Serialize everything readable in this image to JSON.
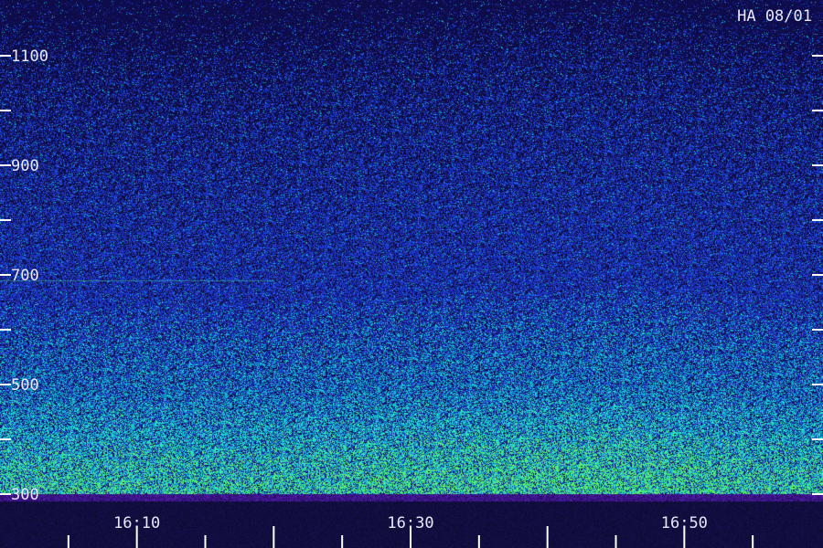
{
  "chart_data": {
    "type": "heatmap",
    "title": "HA 08/01",
    "y_ticks": [
      "1100",
      "900",
      "700",
      "500",
      "300"
    ],
    "y_tick_values": [
      1100,
      900,
      700,
      500,
      300
    ],
    "ylim": [
      300,
      1200
    ],
    "x_ticks": [
      "16:10",
      "16:30",
      "16:50"
    ],
    "x_tick_minutes": [
      10,
      30,
      50
    ],
    "xlim_minutes": [
      0,
      60
    ],
    "minor_ticks": {
      "x_every_minutes": 5,
      "y_every_units": 100
    },
    "colors": {
      "background": "#101048",
      "low": "#2a2ad8",
      "mid": "#28c8e0",
      "high": "#40ff40",
      "axis": "#ffffff"
    },
    "intensity_profile": {
      "description_free_params": true,
      "rows": [
        {
          "freq": 300,
          "level": 0.72
        },
        {
          "freq": 400,
          "level": 0.55
        },
        {
          "freq": 500,
          "level": 0.4
        },
        {
          "freq": 600,
          "level": 0.3
        },
        {
          "freq": 700,
          "level": 0.22
        },
        {
          "freq": 900,
          "level": 0.15
        },
        {
          "freq": 1100,
          "level": 0.1
        },
        {
          "freq": 1200,
          "level": 0.08
        }
      ],
      "columns": [
        {
          "minute": 0,
          "level": 0.55
        },
        {
          "minute": 20,
          "level": 0.5
        },
        {
          "minute": 30,
          "level": 0.75
        },
        {
          "minute": 45,
          "level": 0.95
        },
        {
          "minute": 55,
          "level": 0.6
        },
        {
          "minute": 60,
          "level": 0.5
        }
      ]
    }
  }
}
